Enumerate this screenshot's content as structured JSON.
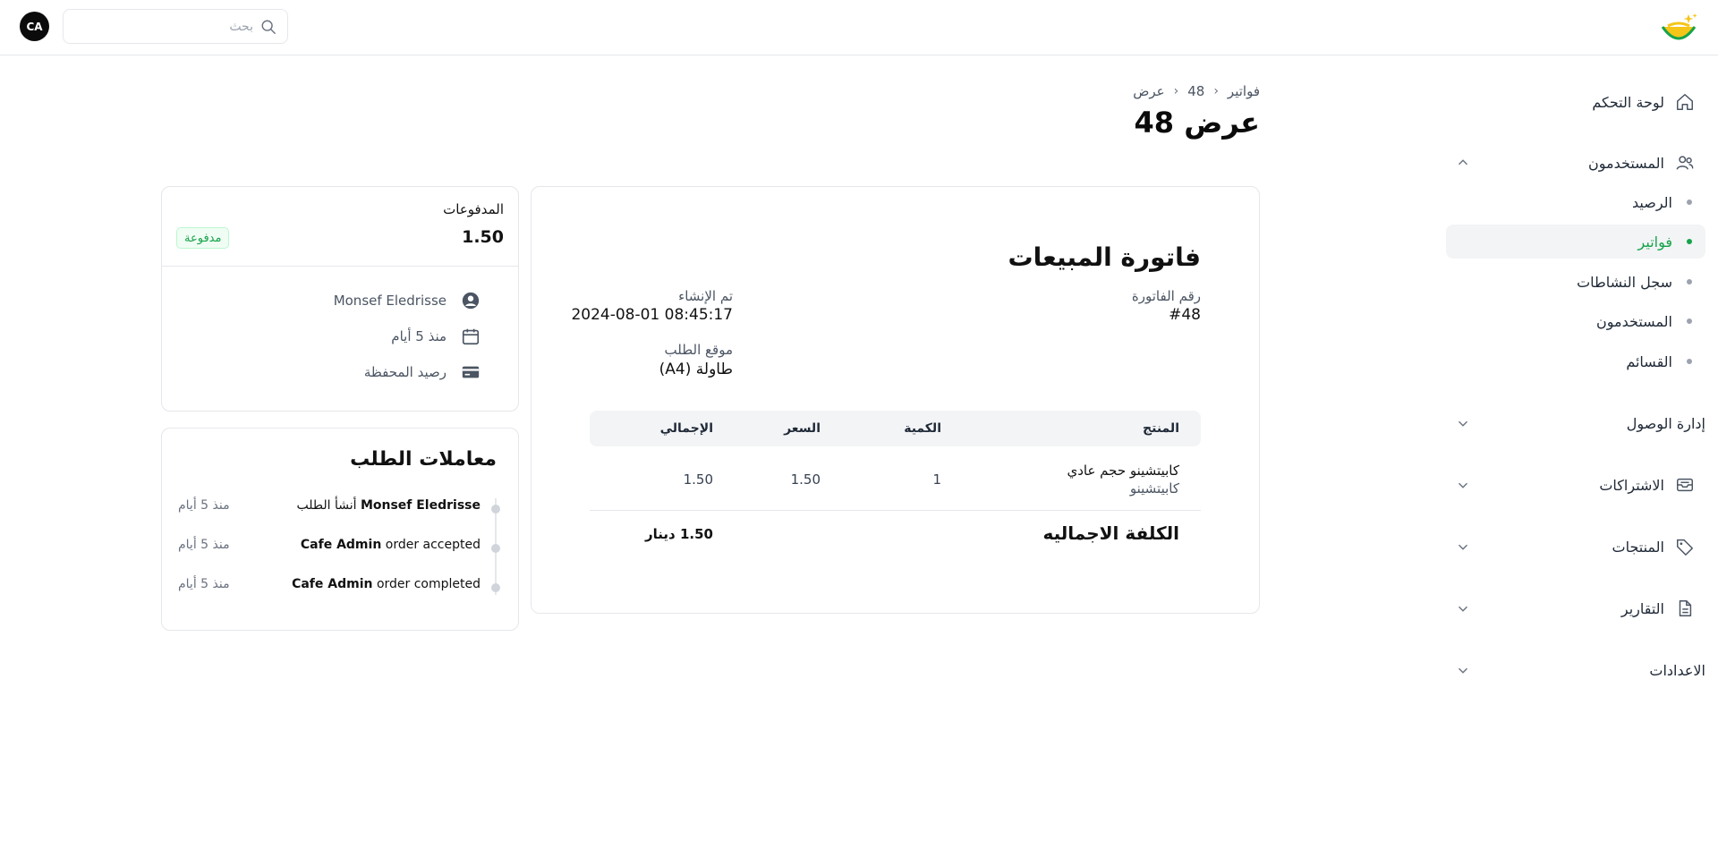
{
  "topbar": {
    "search_placeholder": "بحث",
    "avatar_initials": "CA"
  },
  "sidebar": {
    "dashboard": "لوحة التحكم",
    "users_group": "المستخدمون",
    "users_sub": [
      {
        "label": "الرصيد",
        "active": false
      },
      {
        "label": "فواتير",
        "active": true
      },
      {
        "label": "سجل النشاطات",
        "active": false
      },
      {
        "label": "المستخدمون",
        "active": false
      },
      {
        "label": "القسائم",
        "active": false
      }
    ],
    "access_management": "إدارة الوصول",
    "subscriptions": "الاشتراكات",
    "products": "المنتجات",
    "reports": "التقارير",
    "settings": "الاعدادات"
  },
  "header": {
    "breadcrumb": [
      "فواتير",
      "48",
      "عرض"
    ],
    "title": "عرض 48"
  },
  "invoice": {
    "title": "فاتورة المبيعات",
    "number_label": "رقم الفاتورة",
    "number_value": "#48",
    "created_label": "تم الإنشاء",
    "created_value": "2024-08-01 08:45:17",
    "location_label": "موقع الطلب",
    "location_value": "طاولة (A4)",
    "table": {
      "headers": {
        "product": "المنتج",
        "quantity": "الكمية",
        "price": "السعر",
        "total": "الإجمالي"
      },
      "rows": [
        {
          "product": "كابيتشينو حجم عادي",
          "category": "كابيتشينو",
          "quantity": "1",
          "price": "1.50",
          "total": "1.50"
        }
      ]
    },
    "total_label": "الكلفة الاجماليه",
    "total_value": "1.50 دينار"
  },
  "payments": {
    "title": "المدفوعات",
    "amount": "1.50",
    "status": "مدفوعة",
    "customer": "Monsef Eledrisse",
    "time": "منذ 5 أيام",
    "method": "رصيد المحفظة"
  },
  "transactions": {
    "title": "معاملات الطلب",
    "items": [
      {
        "actor": "Monsef Eledrisse",
        "action": "أنشأ الطلب",
        "time": "منذ 5 أيام"
      },
      {
        "actor": "Cafe Admin",
        "action": "order accepted",
        "time": "منذ 5 أيام"
      },
      {
        "actor": "Cafe Admin",
        "action": "order completed",
        "time": "منذ 5 أيام"
      }
    ]
  },
  "colors": {
    "accent": "#16a34a",
    "border": "#e5e7eb"
  }
}
